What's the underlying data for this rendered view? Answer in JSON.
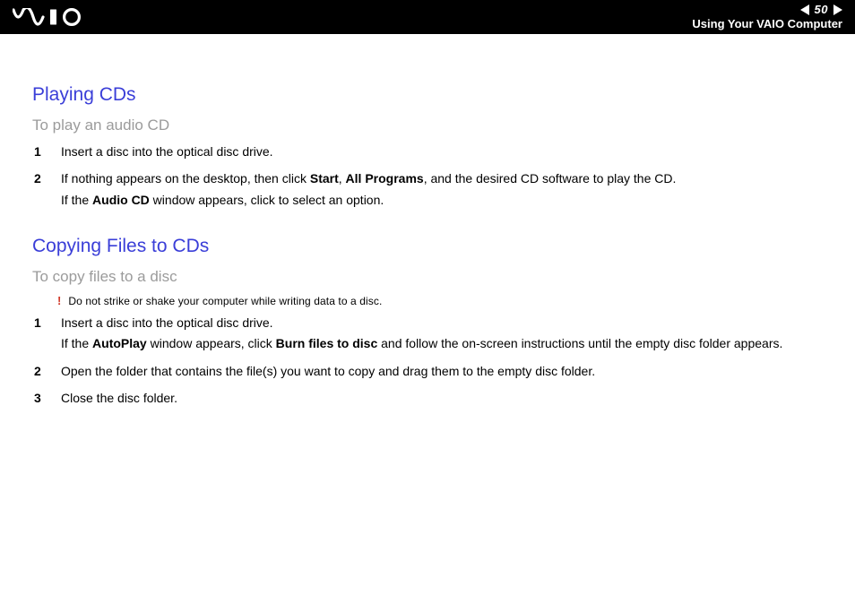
{
  "header": {
    "page_number": "50",
    "breadcrumb": "Using Your VAIO Computer"
  },
  "sections": [
    {
      "title": "Playing CDs",
      "subtitle": "To play an audio CD",
      "warning": null,
      "steps": [
        {
          "num": "1",
          "lines": [
            "Insert a disc into the optical disc drive."
          ]
        },
        {
          "num": "2",
          "lines": [
            "If nothing appears on the desktop, then click <b>Start</b>, <b>All Programs</b>, and the desired CD software to play the CD.",
            "If the <b>Audio CD</b> window appears, click to select an option."
          ]
        }
      ]
    },
    {
      "title": "Copying Files to CDs",
      "subtitle": "To copy files to a disc",
      "warning": "Do not strike or shake your computer while writing data to a disc.",
      "steps": [
        {
          "num": "1",
          "lines": [
            "Insert a disc into the optical disc drive.",
            "If the <b>AutoPlay</b> window appears, click <b>Burn files to disc</b> and follow the on-screen instructions until the empty disc folder appears."
          ]
        },
        {
          "num": "2",
          "lines": [
            "Open the folder that contains the file(s) you want to copy and drag them to the empty disc folder."
          ]
        },
        {
          "num": "3",
          "lines": [
            "Close the disc folder."
          ]
        }
      ]
    }
  ]
}
